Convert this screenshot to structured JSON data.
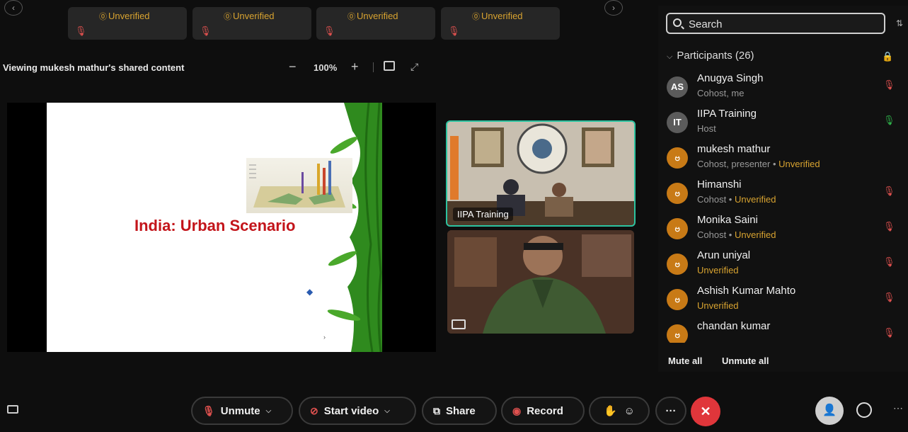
{
  "top_tiles": [
    {
      "status": "Unverified",
      "mic": "mic-muted"
    },
    {
      "status": "Unverified",
      "mic": "mic-muted"
    },
    {
      "status": "Unverified",
      "mic": "mic-muted"
    },
    {
      "status": "Unverified",
      "mic": "mic-speaking"
    }
  ],
  "share_bar": {
    "title": "Viewing mukesh mathur's shared content",
    "zoom_minus": "−",
    "zoom": "100%",
    "zoom_plus": "+"
  },
  "slide": {
    "title": "India: Urban Scenario"
  },
  "videos": [
    {
      "name": "IIPA Training"
    },
    {
      "name": ""
    }
  ],
  "sidebar": {
    "search_placeholder": "Search",
    "participants_header": "Participants (26)",
    "participants": [
      {
        "initials": "AS",
        "name": "Anugya Singh",
        "role": "Cohost, me",
        "unverified": "",
        "mic": "muted"
      },
      {
        "initials": "IT",
        "name": "IIPA Training",
        "role": "Host",
        "unverified": "",
        "mic": "on"
      },
      {
        "initials": "",
        "name": "mukesh mathur",
        "role": "Cohost, presenter • ",
        "unverified": "Unverified",
        "mic": ""
      },
      {
        "initials": "",
        "name": "Himanshi",
        "role": "Cohost • ",
        "unverified": "Unverified",
        "mic": "muted"
      },
      {
        "initials": "",
        "name": "Monika Saini",
        "role": "Cohost • ",
        "unverified": "Unverified",
        "mic": "muted"
      },
      {
        "initials": "",
        "name": "Arun uniyal",
        "role": "",
        "unverified": "Unverified",
        "mic": "muted"
      },
      {
        "initials": "",
        "name": "Ashish Kumar Mahto",
        "role": "",
        "unverified": "Unverified",
        "mic": "muted"
      },
      {
        "initials": "",
        "name": "chandan kumar",
        "role": "",
        "unverified": "",
        "mic": "muted"
      }
    ],
    "mute_all": "Mute all",
    "unmute_all": "Unmute all"
  },
  "controls": {
    "unmute": "Unmute",
    "start_video": "Start video",
    "share": "Share",
    "record": "Record",
    "more": "···",
    "end": "✕"
  },
  "colors": {
    "accent_warning": "#d8a330",
    "muted_red": "#e0514f",
    "active_border": "#2cc3a0",
    "end_call": "#e0363b"
  }
}
